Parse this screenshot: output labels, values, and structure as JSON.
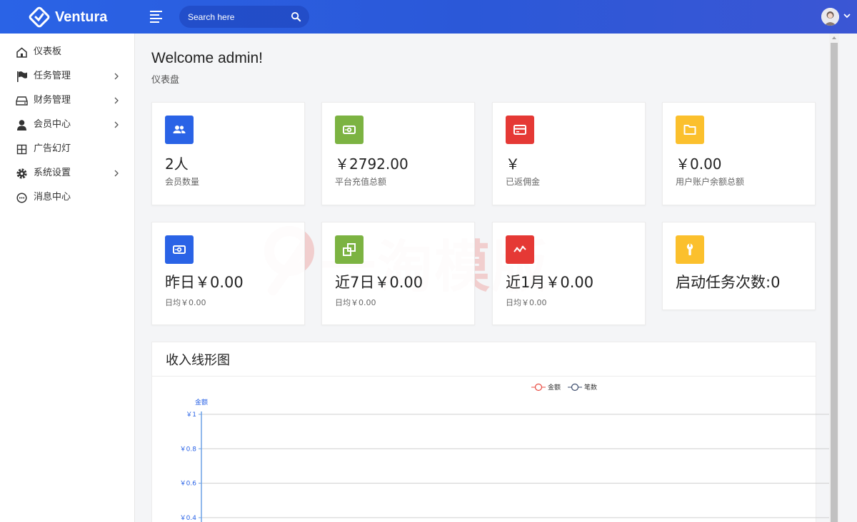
{
  "brand": {
    "name": "Ventura"
  },
  "search": {
    "placeholder": "Search here"
  },
  "sidebar": {
    "items": [
      {
        "label": "仪表板",
        "icon": "home-icon",
        "has_children": false
      },
      {
        "label": "任务管理",
        "icon": "flag-icon",
        "has_children": true
      },
      {
        "label": "财务管理",
        "icon": "drive-icon",
        "has_children": true
      },
      {
        "label": "会员中心",
        "icon": "user-icon",
        "has_children": true
      },
      {
        "label": "广告幻灯",
        "icon": "grid-icon",
        "has_children": false
      },
      {
        "label": "系统设置",
        "icon": "gear-icon",
        "has_children": true
      },
      {
        "label": "消息中心",
        "icon": "chat-icon",
        "has_children": false
      }
    ]
  },
  "page": {
    "title": "Welcome admin!",
    "breadcrumb": "仪表盘"
  },
  "stats_row1": [
    {
      "value": "2人",
      "label": "会员数量",
      "icon": "users-icon",
      "color": "#2a63e6"
    },
    {
      "value": "￥2792.00",
      "label": "平台充值总额",
      "icon": "money-icon",
      "color": "#7cb342"
    },
    {
      "value": "￥",
      "label": "已返佣金",
      "icon": "card-icon",
      "color": "#e53935"
    },
    {
      "value": "￥0.00",
      "label": "用户账户余额总额",
      "icon": "folder-icon",
      "color": "#fbc02d"
    }
  ],
  "stats_row2": [
    {
      "value": "昨日￥0.00",
      "label": "日均￥0.00",
      "icon": "money-icon",
      "color": "#2a63e6"
    },
    {
      "value": "近7日￥0.00",
      "label": "日均￥0.00",
      "icon": "copy-icon",
      "color": "#7cb342"
    },
    {
      "value": "近1月￥0.00",
      "label": "日均￥0.00",
      "icon": "trend-icon",
      "color": "#e53935"
    },
    {
      "value": "启动任务次数:0",
      "label": "",
      "icon": "wrench-icon",
      "color": "#fbc02d"
    }
  ],
  "watermark": {
    "text": "一淘模版"
  },
  "chart": {
    "panel_title": "收入线形图",
    "chart_data": {
      "type": "line",
      "title": "",
      "xlabel": "",
      "ylabel": "金额",
      "ylim": [
        0,
        1
      ],
      "y_ticks": [
        "￥1",
        "￥0.8",
        "￥0.6",
        "￥0.4"
      ],
      "y_tick_values": [
        1,
        0.8,
        0.6,
        0.4
      ],
      "legend_position": "top-center",
      "series": [
        {
          "name": "金额",
          "color": "#e8493f",
          "values": []
        },
        {
          "name": "笔数",
          "color": "#3a4a6b",
          "values": []
        }
      ]
    }
  }
}
